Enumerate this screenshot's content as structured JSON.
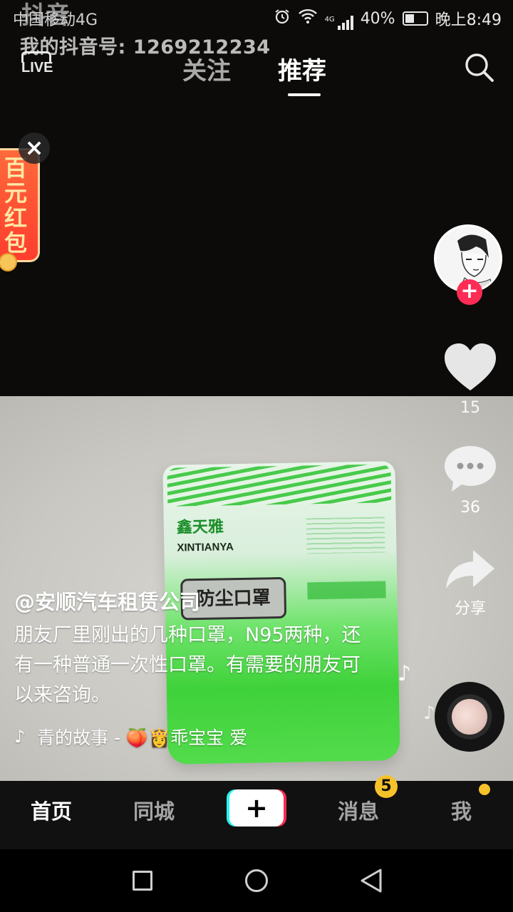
{
  "status_bar": {
    "carrier": "中国移动4G",
    "network": "4G",
    "battery": "40%",
    "time": "晚上8:49"
  },
  "watermark": {
    "logo": "抖音",
    "douyin_id": "我的抖音号: 1269212234"
  },
  "top_nav": {
    "live_label": "LIVE",
    "tabs": [
      {
        "label": "关注",
        "active": false
      },
      {
        "label": "推荐",
        "active": true
      }
    ]
  },
  "red_packet": {
    "label": "百元红包",
    "close": "×"
  },
  "right_rail": {
    "like_count": "15",
    "comment_count": "36",
    "share_label": "分享"
  },
  "post": {
    "author": "@安顺汽车租赁公司",
    "caption": "朋友厂里刚出的几种口罩，N95两种，还有一种普通一次性口罩。有需要的朋友可以来咨询。",
    "music": "青的故事 - 🍑👸乖宝宝   爱"
  },
  "product_in_video": {
    "brand": "鑫天雅",
    "brand_en": "XINTIANYA",
    "label": "防尘口罩"
  },
  "bottom_nav": {
    "items": [
      {
        "label": "首页",
        "active": true
      },
      {
        "label": "同城",
        "active": false
      },
      {
        "label": "消息",
        "active": false
      },
      {
        "label": "我",
        "active": false
      }
    ],
    "create_symbol": "+",
    "messages_badge": "5"
  },
  "colors": {
    "accent_red": "#fe2c55",
    "accent_cyan": "#25f4ee",
    "badge_yellow": "#f6c22a"
  },
  "icons": [
    "alarm-icon",
    "wifi-icon",
    "signal-icon",
    "battery-icon",
    "search-icon",
    "heart-icon",
    "comment-icon",
    "share-icon",
    "music-note-icon",
    "music-disc-icon"
  ]
}
